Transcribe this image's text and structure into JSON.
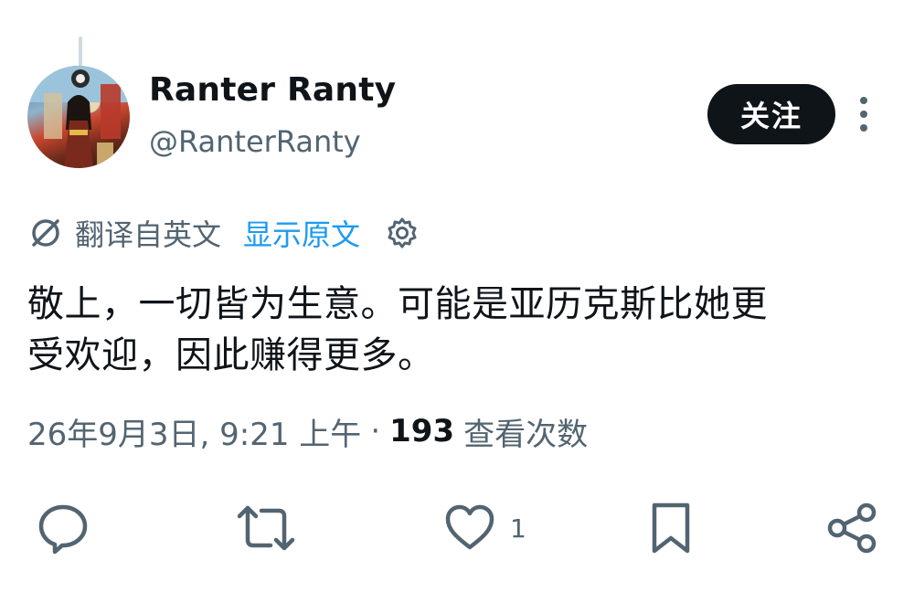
{
  "author": {
    "display_name": "Ranter Ranty",
    "handle": "@RanterRanty"
  },
  "follow_button_label": "关注",
  "translation": {
    "translated_label": "翻译自英文",
    "show_original_label": "显示原文"
  },
  "tweet": {
    "text_line_1": "敬上，一切皆为生意。可能是亚历克斯比她更",
    "text_line_2": "受欢迎，因此赚得更多。"
  },
  "meta": {
    "timestamp": "26年9月3日, 9:21 上午",
    "separator": "·",
    "view_count": "193",
    "view_label": "查看次数"
  },
  "actions": {
    "like_count": "1"
  },
  "icons": {
    "translate": "translate-icon",
    "settings": "gear-icon",
    "reply": "speech-bubble-icon",
    "repost": "repost-arrows-icon",
    "like": "heart-icon",
    "bookmark": "bookmark-icon",
    "share": "share-icon",
    "more": "more-vertical-icon"
  },
  "colors": {
    "text_primary": "#0f1419",
    "text_secondary": "#536471",
    "link": "#1d9bf0",
    "follow_bg": "#0f1419",
    "follow_text": "#ffffff"
  }
}
